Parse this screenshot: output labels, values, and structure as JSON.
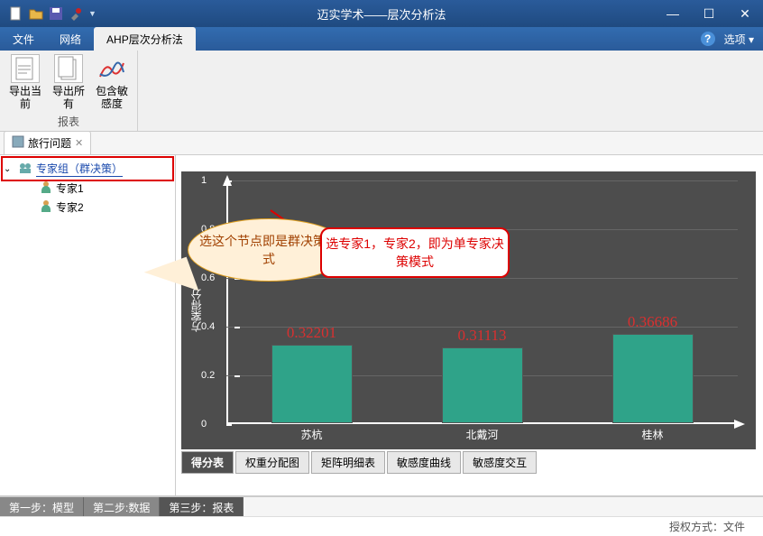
{
  "titlebar": {
    "title": "迈实学术——层次分析法"
  },
  "menubar": {
    "items": [
      "文件",
      "网络",
      "AHP层次分析法"
    ],
    "help_icon_name": "help-icon",
    "options_label": "选项"
  },
  "ribbon": {
    "group_label": "报表",
    "items": [
      {
        "label": "导出当前"
      },
      {
        "label": "导出所有"
      },
      {
        "label": "包含敏感度"
      }
    ]
  },
  "doctab": {
    "label": "旅行问题"
  },
  "tree": {
    "root": "专家组（群决策）",
    "children": [
      "专家1",
      "专家2"
    ]
  },
  "callouts": {
    "top": "选这个节点即是群决策模式",
    "mid": "选专家1，专家2，即为单专家决策模式"
  },
  "chart_data": {
    "type": "bar",
    "ylabel": "方案得分",
    "y_ticks": [
      0,
      0.2,
      0.4,
      0.6,
      0.8,
      1
    ],
    "categories": [
      "苏杭",
      "北戴河",
      "桂林"
    ],
    "values": [
      0.32201,
      0.31113,
      0.36686
    ],
    "ylim": [
      0,
      1
    ]
  },
  "chart_tabs": [
    "得分表",
    "权重分配图",
    "矩阵明细表",
    "敏感度曲线",
    "敏感度交互"
  ],
  "steps": [
    "第一步：模型",
    "第二步:数据",
    "第三步：报表"
  ],
  "statusbar": {
    "text": "授权方式：文件"
  }
}
